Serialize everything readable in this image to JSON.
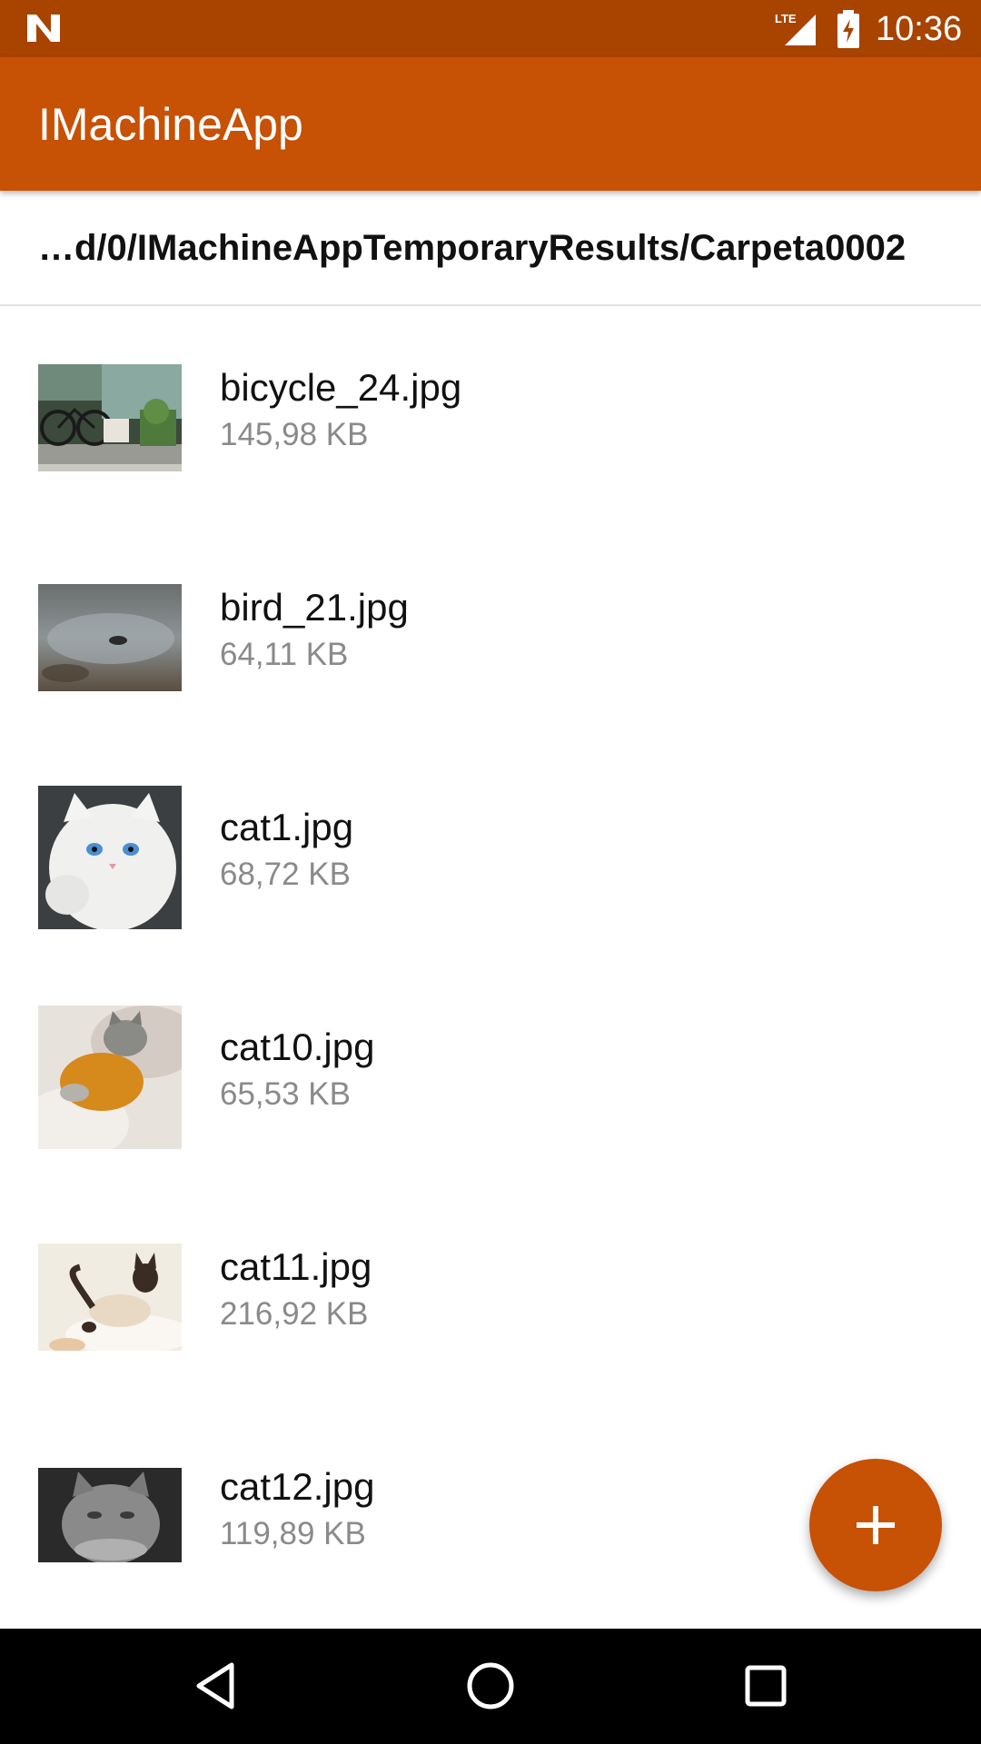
{
  "status_bar": {
    "time": "10:36",
    "network": "LTE",
    "icons": [
      "n-logo-icon",
      "lte-signal-icon",
      "battery-charging-icon"
    ]
  },
  "app_bar": {
    "title": "IMachineApp"
  },
  "path_bar": {
    "path": "…d/0/IMachineAppTemporaryResults/Carpeta0002"
  },
  "files": [
    {
      "name": "bicycle_24.jpg",
      "size": "145,98 KB"
    },
    {
      "name": "bird_21.jpg",
      "size": "64,11 KB"
    },
    {
      "name": "cat1.jpg",
      "size": "68,72 KB"
    },
    {
      "name": "cat10.jpg",
      "size": "65,53 KB"
    },
    {
      "name": "cat11.jpg",
      "size": "216,92 KB"
    },
    {
      "name": "cat12.jpg",
      "size": "119,89 KB"
    }
  ],
  "fab": {
    "icon": "plus-icon"
  },
  "nav_bar": {
    "icons": [
      "back-triangle-icon",
      "home-circle-icon",
      "recents-square-icon"
    ]
  },
  "colors": {
    "status_bar": "#A84300",
    "primary": "#C75105",
    "secondary_text": "#8a8a8a"
  }
}
